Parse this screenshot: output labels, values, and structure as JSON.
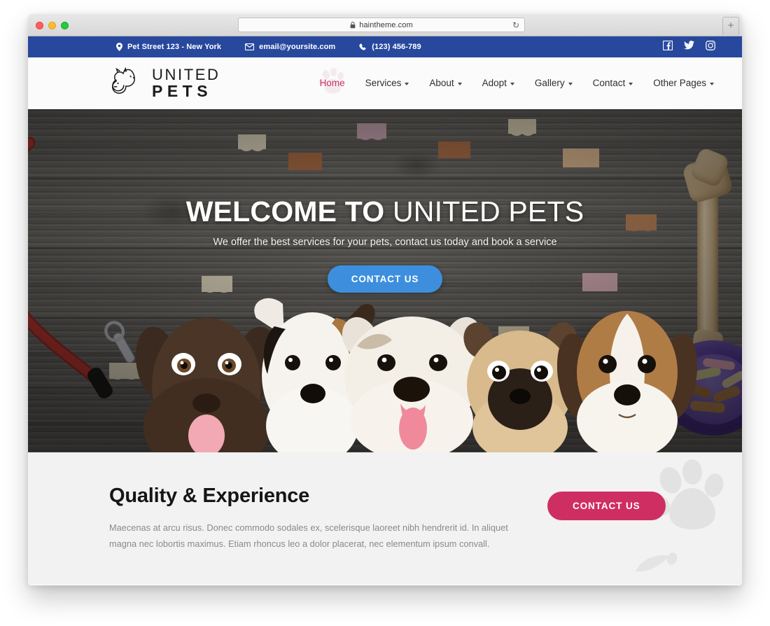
{
  "browser": {
    "url": "haintheme.com",
    "lock_icon": "lock-icon",
    "reload_icon": "reload-icon",
    "newtab_label": "+",
    "traffic_lights": [
      "close",
      "minimize",
      "zoom"
    ]
  },
  "topbar": {
    "background": "#27489d",
    "items": [
      {
        "icon": "map-marker-icon",
        "label": "Pet Street 123 - New York"
      },
      {
        "icon": "envelope-icon",
        "label": "email@yoursite.com"
      },
      {
        "icon": "phone-icon",
        "label": "(123) 456-789"
      }
    ],
    "social": [
      {
        "icon": "facebook-icon",
        "label": "Facebook"
      },
      {
        "icon": "twitter-icon",
        "label": "Twitter"
      },
      {
        "icon": "instagram-icon",
        "label": "Instagram"
      }
    ]
  },
  "header": {
    "logo": {
      "icon": "dog-cat-logo-icon",
      "line1": "UNITED",
      "line2": "PETS"
    },
    "nav": [
      {
        "label": "Home",
        "active": true,
        "caret": false
      },
      {
        "label": "Services",
        "active": false,
        "caret": true
      },
      {
        "label": "About",
        "active": false,
        "caret": true
      },
      {
        "label": "Adopt",
        "active": false,
        "caret": true
      },
      {
        "label": "Gallery",
        "active": false,
        "caret": true
      },
      {
        "label": "Contact",
        "active": false,
        "caret": true
      },
      {
        "label": "Other Pages",
        "active": false,
        "caret": true
      }
    ],
    "active_color": "#c73362"
  },
  "hero": {
    "title_bold": "WELCOME TO",
    "title_light": "UNITED PETS",
    "subtitle": "We offer the best services for your pets, contact us today and book a service",
    "button_label": "CONTACT US",
    "button_color": "#3d8fdd"
  },
  "quality": {
    "title": "Quality & Experience",
    "body": "Maecenas at arcu risus. Donec commodo sodales ex, scelerisque laoreet nibh hendrerit id. In aliquet magna nec lobortis maximus. Etiam rhoncus leo a dolor placerat, nec elementum ipsum convall.",
    "button_label": "CONTACT US",
    "button_color": "#cf2e63",
    "watermark_icon": "paw-print-icon"
  }
}
